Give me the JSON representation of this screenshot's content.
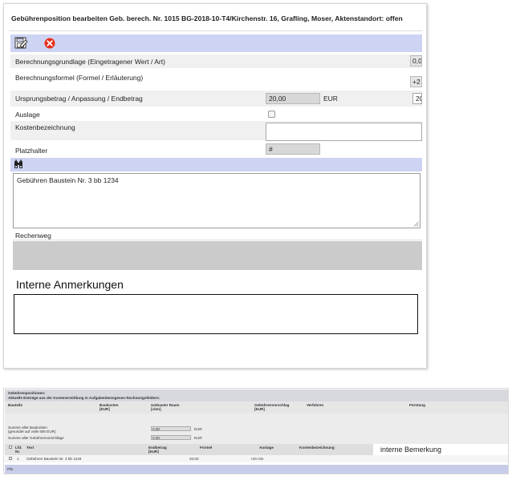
{
  "dialog": {
    "title": "Gebührenposition bearbeiten Geb. berech. Nr. 1015 BG-2018-10-T4/Kirchenstr. 16, Grafling, Moser, Aktenstandort: offen",
    "toolbar": {
      "save_icon": "save-icon",
      "cancel_icon": "cancel-icon"
    },
    "fields": {
      "berechnungsgrundlage_label": "Berechnungsgrundlage (Eingetragener Wert / Art)",
      "berechnungsgrundlage_value": "0,0",
      "berechnungsformel_label": "Berechnungsformel (Formel / Erläuterung)",
      "berechnungsformel_value": "+2",
      "ursprungsbetrag_label": "Ursprungsbetrag / Anpassung / Endbetrag",
      "ursprungsbetrag_value": "20,00",
      "ursprungsbetrag_unit": "EUR",
      "endbetrag_value": "20",
      "auslage_label": "Auslage",
      "kostenbezeichnung_label": "Kostenbezeichnung",
      "kostenbezeichnung_value": "",
      "platzhalter_label": "Platzhalter",
      "platzhalter_value": "#"
    },
    "text_tool_icon": "binoculars-icon",
    "text_area_value": "Gebühren Baustein Nr. 3 bb 1234",
    "rechenweg_label": "Rechenweg",
    "interne_anmerkungen_title": "Interne Anmerkungen",
    "interne_anmerkungen_value": ""
  },
  "mini": {
    "header_line1": "Gebührenpositionen:",
    "header_line2": "Aktuelle Einträge aus der Kostenermittlung in Aufgabenbezogenen Rechnungsfeldern:",
    "columns": {
      "c1": "Bauteile",
      "c2": "Baukosten\n[EUR]",
      "c3": "Umbauter Raum\n[cbm]",
      "c4": "Gebührenvorschlag\n[EUR]",
      "c5": "Verfahren",
      "c6": "Förstung"
    },
    "sum_baukosten_label": "Summe aller Baukosten\n(gerundet auf volle 500 EUR)",
    "sum_baukosten_value": "0,00",
    "sum_baukosten_unit": "EUR",
    "sum_gebuehren_label": "Summe aller Gebührenvorschläge",
    "sum_gebuehren_value": "0,00",
    "sum_gebuehren_unit": "EUR",
    "table_header": {
      "lfd": "Lfd.",
      "nr": "Nr.",
      "text": "Text",
      "endbetrag": "Endbetrag\n[EUR]",
      "formel": "Formel",
      "auslage": "Auslage",
      "kostenbezeichnung": "Kostenbezeichnung",
      "interne_bemerkung": "interne Bemerkung"
    },
    "rows": [
      {
        "nr": "1",
        "text": "Gebühren Baustein Nr. 3 bb 1234",
        "endbetrag": "20,00",
        "formel": "+20 min"
      }
    ],
    "footer_text": "Pfä"
  },
  "colors": {
    "toolbar_band": "#cdd3f2",
    "cancel_red": "#e8301c",
    "panel_grey": "#cbcbcb"
  }
}
